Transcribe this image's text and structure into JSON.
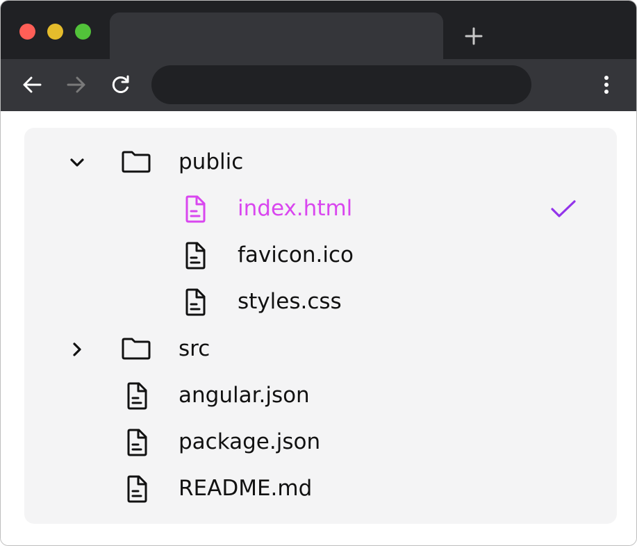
{
  "browser": {
    "window_controls": [
      "close",
      "minimize",
      "maximize"
    ],
    "colors": {
      "close": "#ff5f57",
      "minimize": "#e5bc2c",
      "maximize": "#52c23a",
      "titlebar": "#202124",
      "toolbar": "#35363a",
      "accent_selected": "#d946ef",
      "check": "#9333ea"
    },
    "new_tab_icon": "plus-icon",
    "back_icon": "arrow-left-icon",
    "forward_icon": "arrow-right-icon",
    "reload_icon": "reload-icon",
    "menu_icon": "kebab-menu-icon",
    "address": ""
  },
  "file_tree": {
    "items": [
      {
        "label": "public",
        "type": "folder",
        "expanded": true,
        "depth": 0,
        "selected": false
      },
      {
        "label": "index.html",
        "type": "file",
        "depth": 1,
        "selected": true
      },
      {
        "label": "favicon.ico",
        "type": "file",
        "depth": 1,
        "selected": false
      },
      {
        "label": "styles.css",
        "type": "file",
        "depth": 1,
        "selected": false
      },
      {
        "label": "src",
        "type": "folder",
        "expanded": false,
        "depth": 0,
        "selected": false
      },
      {
        "label": "angular.json",
        "type": "file",
        "depth": 0,
        "selected": false
      },
      {
        "label": "package.json",
        "type": "file",
        "depth": 0,
        "selected": false
      },
      {
        "label": "README.md",
        "type": "file",
        "depth": 0,
        "selected": false
      }
    ]
  }
}
